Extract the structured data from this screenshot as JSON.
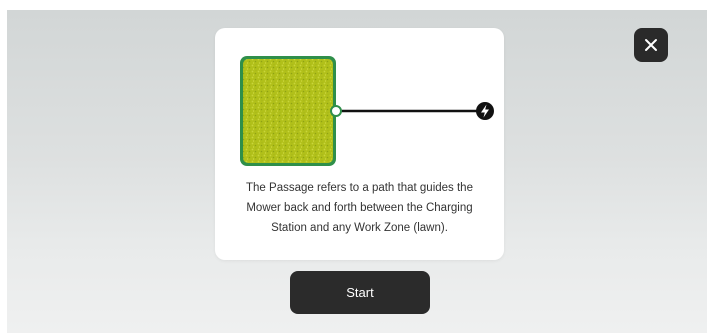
{
  "dialog": {
    "description": "The Passage refers to a path that guides the Mower back and forth between the Charging Station and any Work Zone (lawn)."
  },
  "diagram": {
    "work_zone_icon": "lawn-tile",
    "charging_station_icon": "lightning-bolt-icon",
    "colors": {
      "lawn_fill": "#b3c21a",
      "lawn_border": "#2f8f4a",
      "path_line": "#111111"
    }
  },
  "actions": {
    "start_label": "Start",
    "close_icon": "close-icon"
  }
}
